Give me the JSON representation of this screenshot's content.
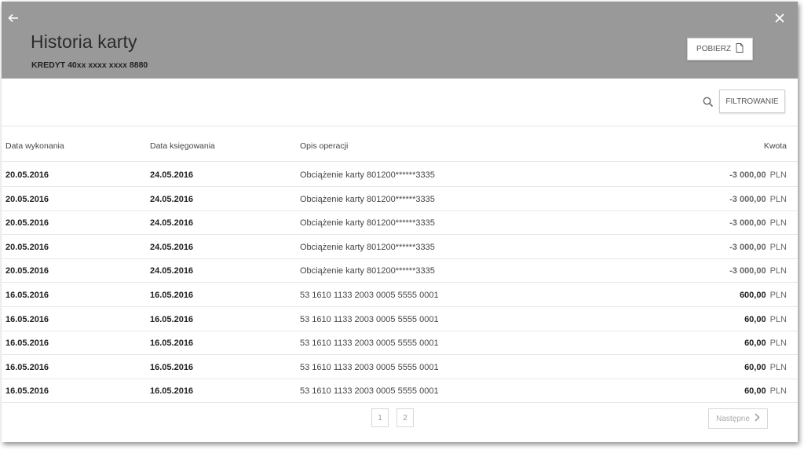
{
  "header": {
    "title": "Historia karty",
    "subtitle": "KREDYT 40xx xxxx xxxx 8880",
    "download_label": "POBIERZ"
  },
  "toolbar": {
    "filter_label": "FILTROWANIE"
  },
  "table": {
    "columns": [
      "Data wykonania",
      "Data księgowania",
      "Opis operacji",
      "Kwota"
    ],
    "rows": [
      {
        "date_exec": "20.05.2016",
        "date_post": "24.05.2016",
        "description": "Obciążenie karty 801200******3335",
        "amount": "-3 000,00",
        "currency": "PLN"
      },
      {
        "date_exec": "20.05.2016",
        "date_post": "24.05.2016",
        "description": "Obciążenie karty 801200******3335",
        "amount": "-3 000,00",
        "currency": "PLN"
      },
      {
        "date_exec": "20.05.2016",
        "date_post": "24.05.2016",
        "description": "Obciążenie karty 801200******3335",
        "amount": "-3 000,00",
        "currency": "PLN"
      },
      {
        "date_exec": "20.05.2016",
        "date_post": "24.05.2016",
        "description": "Obciążenie karty 801200******3335",
        "amount": "-3 000,00",
        "currency": "PLN"
      },
      {
        "date_exec": "20.05.2016",
        "date_post": "24.05.2016",
        "description": "Obciążenie karty 801200******3335",
        "amount": "-3 000,00",
        "currency": "PLN"
      },
      {
        "date_exec": "16.05.2016",
        "date_post": "16.05.2016",
        "description": "53 1610 1133 2003 0005 5555 0001",
        "amount": "600,00",
        "currency": "PLN"
      },
      {
        "date_exec": "16.05.2016",
        "date_post": "16.05.2016",
        "description": "53 1610 1133 2003 0005 5555 0001",
        "amount": "60,00",
        "currency": "PLN"
      },
      {
        "date_exec": "16.05.2016",
        "date_post": "16.05.2016",
        "description": "53 1610 1133 2003 0005 5555 0001",
        "amount": "60,00",
        "currency": "PLN"
      },
      {
        "date_exec": "16.05.2016",
        "date_post": "16.05.2016",
        "description": "53 1610 1133 2003 0005 5555 0001",
        "amount": "60,00",
        "currency": "PLN"
      },
      {
        "date_exec": "16.05.2016",
        "date_post": "16.05.2016",
        "description": "53 1610 1133 2003 0005 5555 0001",
        "amount": "60,00",
        "currency": "PLN"
      }
    ]
  },
  "pagination": {
    "pages": [
      "1",
      "2"
    ],
    "next_label": "Następne"
  },
  "colors": {
    "header_bg": "#999999",
    "negative_amount": "#666666"
  }
}
